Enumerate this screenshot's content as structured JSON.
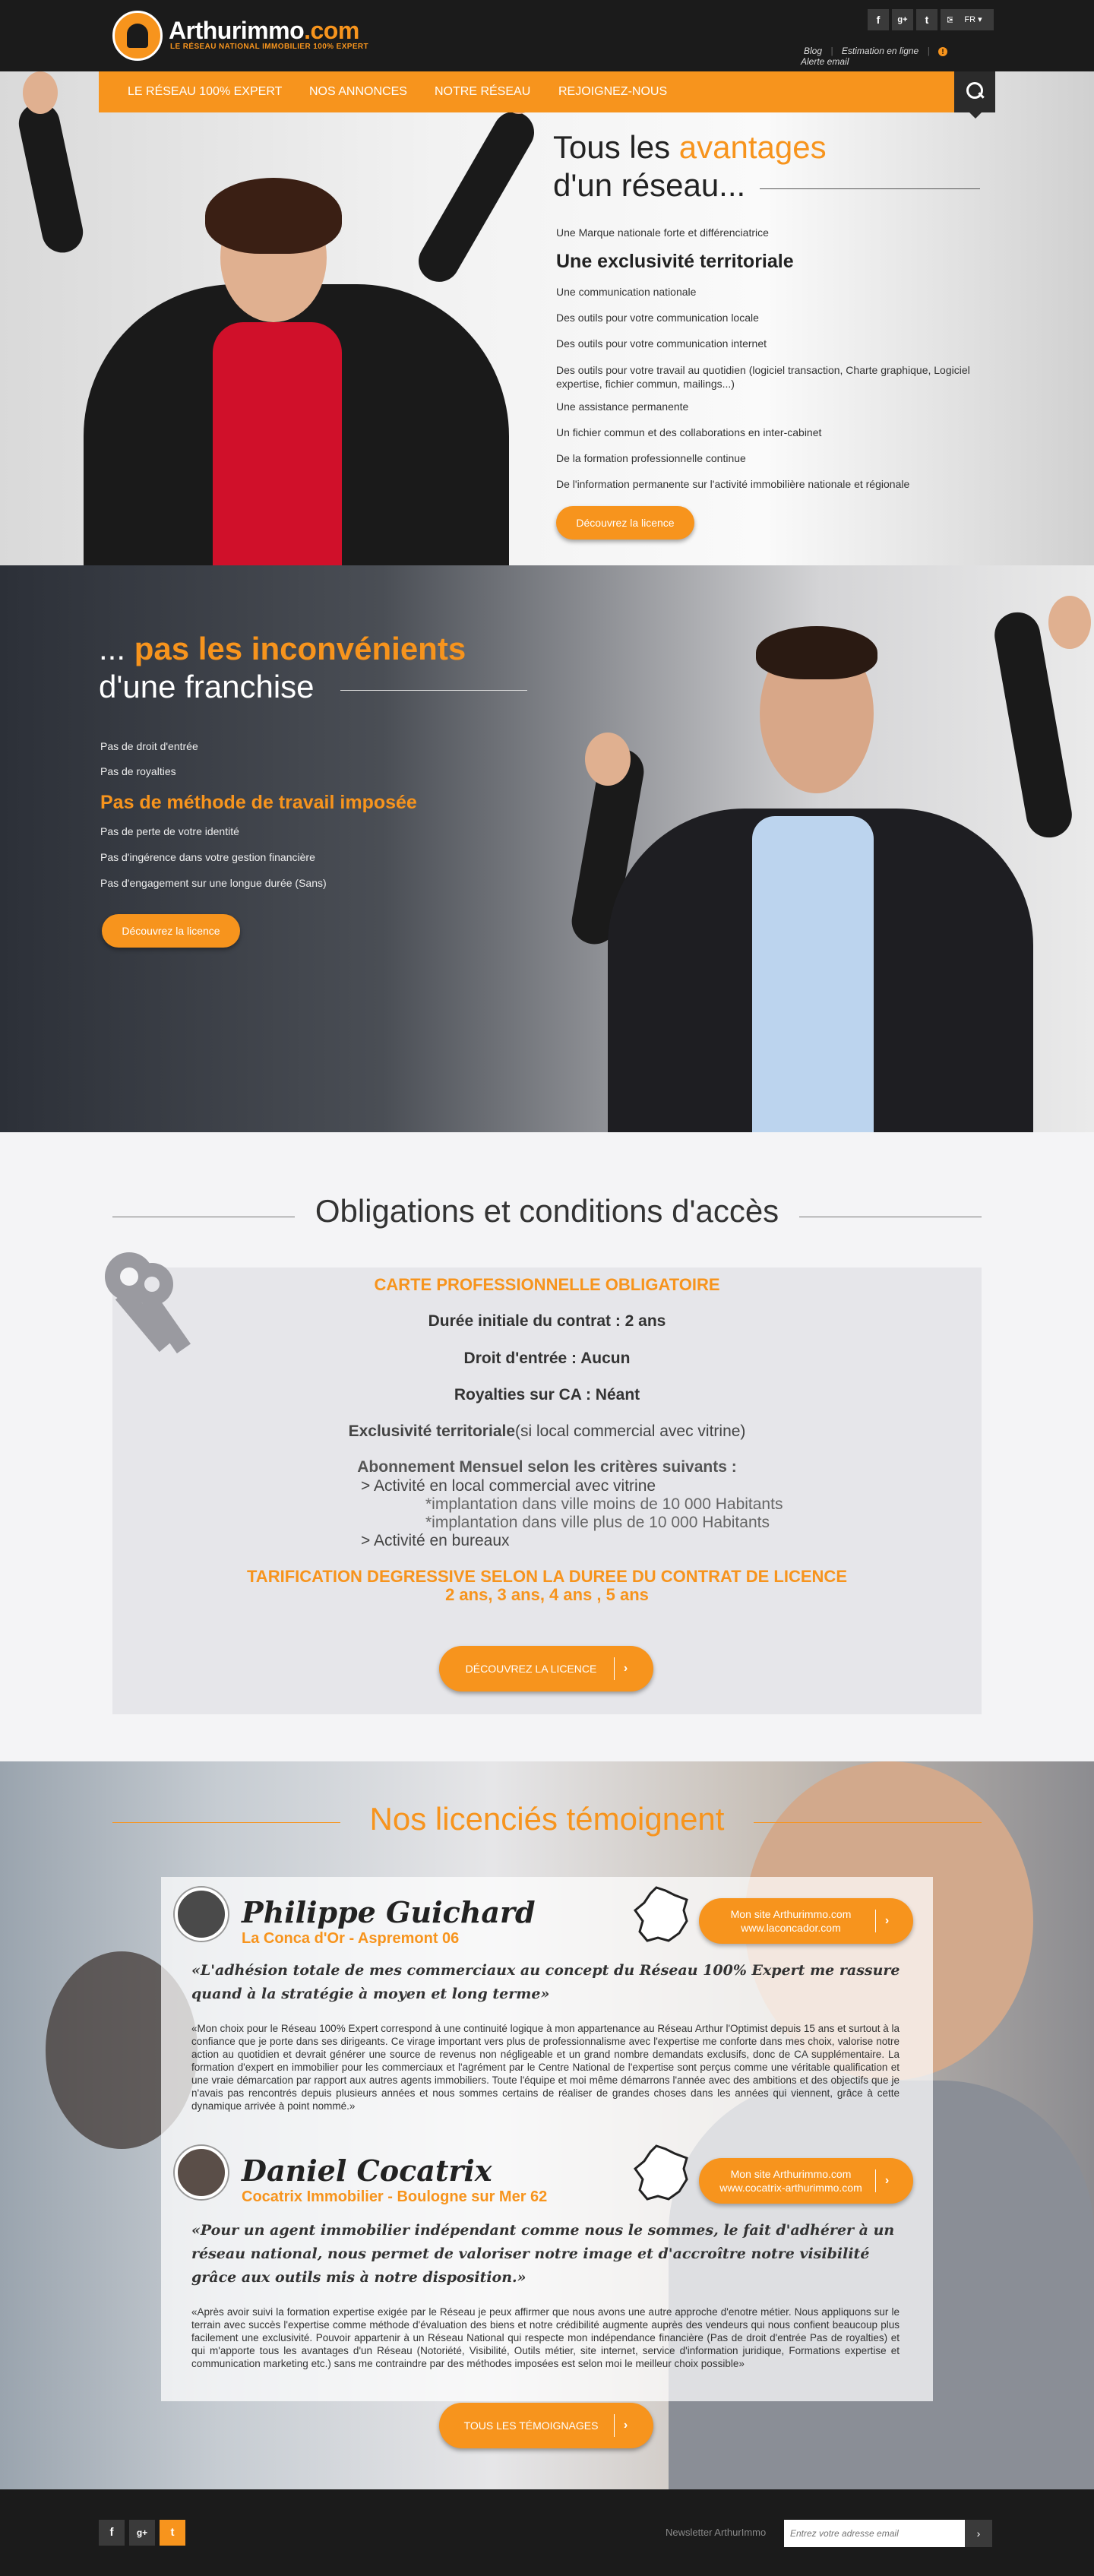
{
  "header": {
    "brand": "Arthurimmo",
    "brand_tld": ".com",
    "tagline": "LE RÉSEAU NATIONAL IMMOBILIER 100% EXPERT",
    "social": [
      "f",
      "g+",
      "t",
      "✉"
    ],
    "language": "FR",
    "links": {
      "blog": "Blog",
      "sep1": "|",
      "estimation": "Estimation en ligne",
      "sep2": "|",
      "alert_icon": "!",
      "alert": "Alerte email"
    }
  },
  "nav": {
    "items": [
      "LE RÉSEAU 100% EXPERT",
      "NOS ANNONCES",
      "NOTRE RÉSEAU",
      "REJOIGNEZ-NOUS"
    ]
  },
  "hero1": {
    "title_pre": "Tous les ",
    "title_highlight": "avantages",
    "title_line2": "d'un réseau...",
    "items": [
      {
        "text": "Une Marque nationale forte et différenciatrice",
        "big": false
      },
      {
        "text": "Une exclusivité territoriale",
        "big": true
      },
      {
        "text": "Une communication nationale",
        "big": false
      },
      {
        "text": "Des outils pour votre communication locale",
        "big": false
      },
      {
        "text": "Des outils pour votre communication internet",
        "big": false
      },
      {
        "text": "Des outils pour votre travail au quotidien (logiciel transaction, Charte graphique, Logiciel expertise, fichier commun, mailings...)",
        "big": false
      },
      {
        "text": "Une assistance permanente",
        "big": false
      },
      {
        "text": "Un fichier commun et des collaborations en inter-cabinet",
        "big": false
      },
      {
        "text": "De la formation professionnelle continue",
        "big": false
      },
      {
        "text": "De l'information permanente sur l'activité immobilière nationale et régionale",
        "big": false
      }
    ],
    "cta": "Découvrez la licence"
  },
  "hero2": {
    "title_pre": "... ",
    "title_highlight": "pas les inconvénients",
    "title_line2": "d'une franchise",
    "items": [
      {
        "text": "Pas de droit d'entrée",
        "big": false
      },
      {
        "text": "Pas de royalties",
        "big": false
      },
      {
        "text": "Pas de méthode de travail imposée",
        "big": true
      },
      {
        "text": "Pas de perte de votre identité",
        "big": false
      },
      {
        "text": "Pas d'ingérence dans votre gestion financière",
        "big": false
      },
      {
        "text": "Pas d'engagement sur une longue durée (Sans)",
        "big": false
      }
    ],
    "cta": "Découvrez la licence"
  },
  "obligations": {
    "title": "Obligations et conditions d'accès",
    "card": "CARTE PROFESSIONNELLE OBLIGATOIRE",
    "duree": "Durée initiale du contrat : 2 ans",
    "droit": "Droit d'entrée : Aucun",
    "royalties": "Royalties sur CA : Néant",
    "exclu_bold": "Exclusivité territoriale",
    "exclu_rest": "(si local commercial avec vitrine)",
    "abo": "Abonnement Mensuel selon les critères suivants :",
    "abo_1": "> Activité en local commercial avec vitrine",
    "abo_1a": "*implantation dans ville moins de 10 000 Habitants",
    "abo_1b": "*implantation dans ville plus de 10 000 Habitants",
    "abo_2": "> Activité en bureaux",
    "tarif": "TARIFICATION DEGRESSIVE SELON LA DUREE DU CONTRAT DE LICENCE",
    "tarif_durees": "2 ans,  3 ans,  4 ans , 5 ans",
    "cta": "DÉCOUVREZ LA LICENCE",
    "cta_arrow": "›"
  },
  "testimonials": {
    "title": "Nos licenciés témoignent",
    "items": [
      {
        "name": "Philippe Guichard",
        "agency": "La Conca d'Or - Aspremont 06",
        "site_label": "Mon site Arthurimmo.com",
        "site_url": "www.laconcador.com",
        "quote": "«L'adhésion totale de mes commerciaux au concept du Réseau 100% Expert me rassure quand à la stratégie à moyen et long terme»",
        "body": "«Mon choix pour le Réseau 100% Expert correspond à une continuité logique à mon appartenance au Réseau Arthur l'Optimist depuis 15 ans et surtout à la confiance que je porte dans ses dirigeants. Ce virage important vers plus de professionnalisme avec l'expertise me conforte dans mes choix, valorise notre action au quotidien et devrait générer une source de revenus non négligeable et un grand nombre demandats exclusifs, donc de CA supplémentaire. La formation d'expert en immobilier pour les commerciaux et l'agrément par le Centre National de l'expertise sont perçus comme une véritable qualification et une vraie démarcation par rapport aux autres agents immobiliers. Toute l'équipe et moi même démarrons l'année avec des ambitions et des objectifs que je n'avais pas rencontrés depuis plusieurs années et nous sommes certains de réaliser de grandes choses dans les années qui viennent, grâce à cette dynamique arrivée à point nommé.»"
      },
      {
        "name": "Daniel Cocatrix",
        "agency": "Cocatrix Immobilier - Boulogne sur Mer 62",
        "site_label": "Mon site Arthurimmo.com",
        "site_url": "www.cocatrix-arthurimmo.com",
        "quote": "«Pour un agent immobilier indépendant comme nous le sommes, le fait d'adhérer à un réseau national, nous permet de valoriser notre image et d'accroître notre visibilité grâce aux outils mis à notre disposition.»",
        "body": "«Après avoir suivi la formation expertise exigée par le Réseau je peux affirmer que nous avons une autre approche d'enotre métier. Nous appliquons sur le terrain avec succès l'expertise comme méthode d'évaluation des biens et notre crédibilité augmente auprès des vendeurs qui nous confient beaucoup plus facilement une exclusivité. Pouvoir appartenir à un Réseau National qui respecte mon indépendance financière (Pas de droit d'entrée Pas de royalties) et qui m'apporte tous les avantages d'un Réseau (Notoriété, Visibilité, Outils métier, site internet, service d'information juridique, Formations expertise et communication marketing etc.) sans me contraindre par des méthodes imposées est selon moi le meilleur choix possible»"
      }
    ],
    "cta": "TOUS LES TÉMOIGNAGES",
    "cta_arrow": "›"
  },
  "footer": {
    "social": [
      "f",
      "g+",
      "t"
    ],
    "newsletter_label": "Newsletter ArthurImmo",
    "newsletter_placeholder": "Entrez votre adresse email",
    "newsletter_submit": "›"
  },
  "colors": {
    "accent": "#f7941d",
    "dark": "#1b1b1b"
  }
}
